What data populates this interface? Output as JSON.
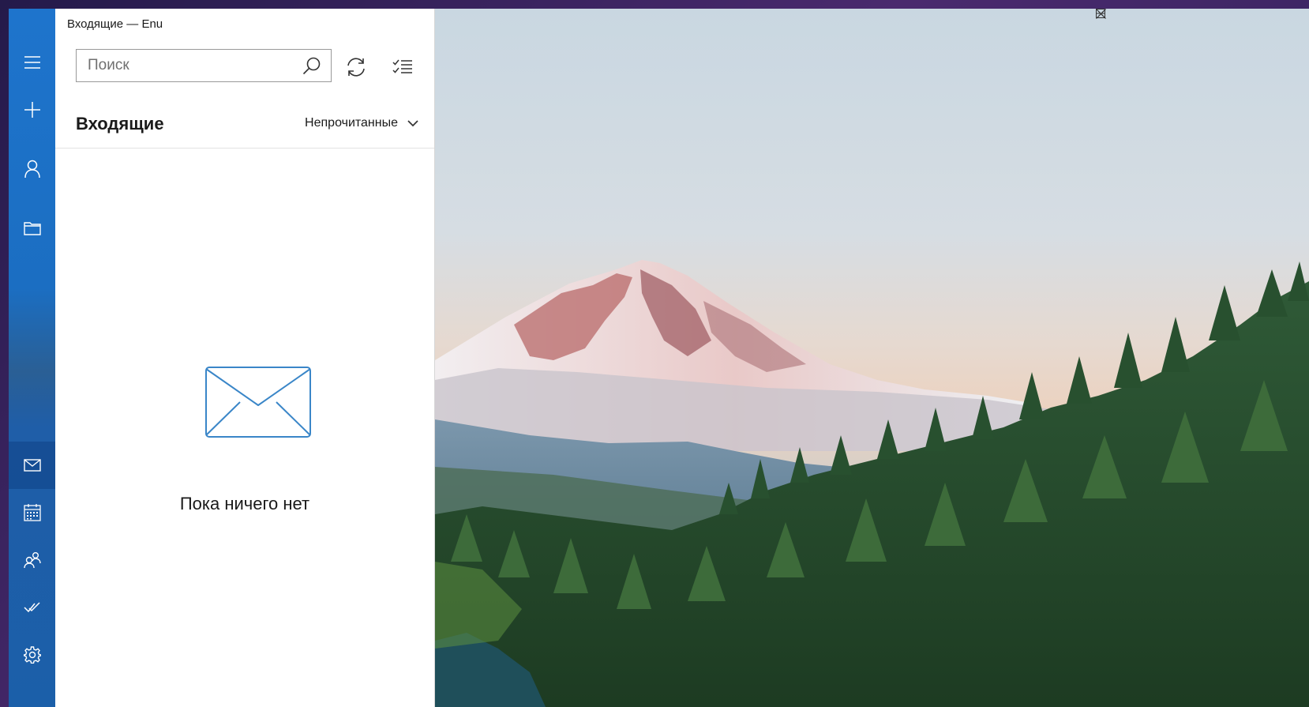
{
  "window": {
    "title": "Входящие — Enu",
    "caption_buttons": [
      "minimize-icon",
      "maximize-icon",
      "close-icon"
    ]
  },
  "rail": {
    "items": [
      {
        "id": "menu",
        "icon": "hamburger-icon"
      },
      {
        "id": "new-mail",
        "icon": "plus-icon"
      },
      {
        "id": "accounts",
        "icon": "person-icon"
      },
      {
        "id": "folders",
        "icon": "folder-icon"
      },
      {
        "id": "mail",
        "icon": "mail-icon",
        "active": true
      },
      {
        "id": "calendar",
        "icon": "calendar-icon"
      },
      {
        "id": "people",
        "icon": "people-icon"
      },
      {
        "id": "todo",
        "icon": "check-icon"
      },
      {
        "id": "settings",
        "icon": "gear-icon"
      }
    ]
  },
  "toolbar": {
    "search_placeholder": "Поиск",
    "search_value": "",
    "sync_icon": "sync-icon",
    "select_icon": "select-mode-icon"
  },
  "folder": {
    "title": "Входящие",
    "filter_label": "Непрочитанные"
  },
  "empty_state": {
    "icon": "envelope-icon",
    "message": "Пока ничего нет"
  },
  "colors": {
    "rail": "#1b6ec2",
    "accent": "#3a86c8"
  }
}
